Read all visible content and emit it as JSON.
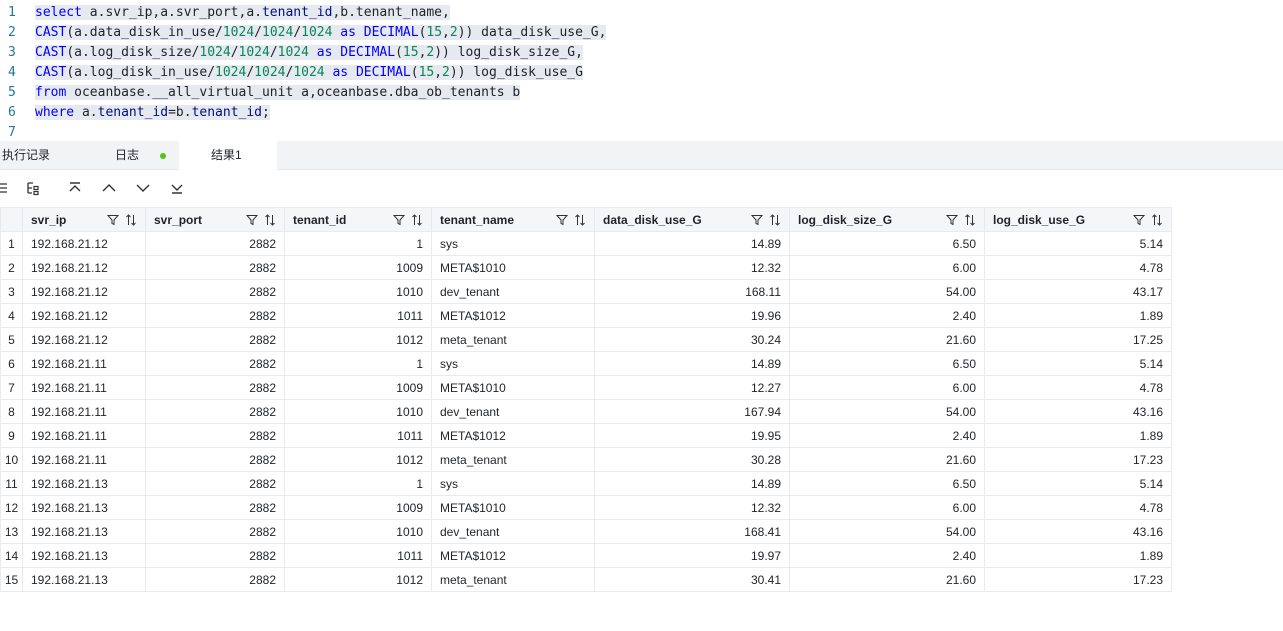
{
  "editor": {
    "lines": [
      {
        "no": "1"
      },
      {
        "no": "2"
      },
      {
        "no": "3"
      },
      {
        "no": "4"
      },
      {
        "no": "5"
      },
      {
        "no": "6"
      },
      {
        "no": "7"
      }
    ],
    "tokens": {
      "l1": [
        "select",
        " a.svr_ip,a.svr_port,a.",
        "tenant_id",
        ",b.tenant_name,"
      ],
      "l2": [
        "CAST",
        "(a.data_disk_in_use/",
        "1024",
        "/",
        "1024",
        "/",
        "1024",
        " as ",
        "DECIMAL",
        "(",
        "15",
        ",",
        "2",
        ")) data_disk_use_G,"
      ],
      "l3": [
        "CAST",
        "(a.log_disk_size/",
        "1024",
        "/",
        "1024",
        "/",
        "1024",
        " as ",
        "DECIMAL",
        "(",
        "15",
        ",",
        "2",
        ")) log_disk_size_G,"
      ],
      "l4": [
        "CAST",
        "(a.log_disk_in_use/",
        "1024",
        "/",
        "1024",
        "/",
        "1024",
        " as ",
        "DECIMAL",
        "(",
        "15",
        ",",
        "2",
        ")) log_disk_use_G"
      ],
      "l5": [
        "from",
        " oceanbase.__all_virtual_unit a,oceanbase.dba_ob_tenants b"
      ],
      "l6": [
        "where",
        " a.",
        "tenant_id",
        "=",
        "b.",
        "tenant_id",
        ";"
      ]
    }
  },
  "tabs": {
    "history": "执行记录",
    "log": "日志",
    "result": "结果1",
    "log_status_color": "#52c41a"
  },
  "toolbar": {
    "icons": [
      "column-settings-icon",
      "tree-structure-icon",
      "jump-first-icon",
      "move-up-icon",
      "move-down-icon",
      "jump-last-icon"
    ]
  },
  "grid": {
    "columns": [
      "svr_ip",
      "svr_port",
      "tenant_id",
      "tenant_name",
      "data_disk_use_G",
      "log_disk_size_G",
      "log_disk_use_G"
    ],
    "rows": [
      [
        "1",
        "192.168.21.12",
        "2882",
        "1",
        "sys",
        "14.89",
        "6.50",
        "5.14"
      ],
      [
        "2",
        "192.168.21.12",
        "2882",
        "1009",
        "META$1010",
        "12.32",
        "6.00",
        "4.78"
      ],
      [
        "3",
        "192.168.21.12",
        "2882",
        "1010",
        "dev_tenant",
        "168.11",
        "54.00",
        "43.17"
      ],
      [
        "4",
        "192.168.21.12",
        "2882",
        "1011",
        "META$1012",
        "19.96",
        "2.40",
        "1.89"
      ],
      [
        "5",
        "192.168.21.12",
        "2882",
        "1012",
        "meta_tenant",
        "30.24",
        "21.60",
        "17.25"
      ],
      [
        "6",
        "192.168.21.11",
        "2882",
        "1",
        "sys",
        "14.89",
        "6.50",
        "5.14"
      ],
      [
        "7",
        "192.168.21.11",
        "2882",
        "1009",
        "META$1010",
        "12.27",
        "6.00",
        "4.78"
      ],
      [
        "8",
        "192.168.21.11",
        "2882",
        "1010",
        "dev_tenant",
        "167.94",
        "54.00",
        "43.16"
      ],
      [
        "9",
        "192.168.21.11",
        "2882",
        "1011",
        "META$1012",
        "19.95",
        "2.40",
        "1.89"
      ],
      [
        "10",
        "192.168.21.11",
        "2882",
        "1012",
        "meta_tenant",
        "30.28",
        "21.60",
        "17.23"
      ],
      [
        "11",
        "192.168.21.13",
        "2882",
        "1",
        "sys",
        "14.89",
        "6.50",
        "5.14"
      ],
      [
        "12",
        "192.168.21.13",
        "2882",
        "1009",
        "META$1010",
        "12.32",
        "6.00",
        "4.78"
      ],
      [
        "13",
        "192.168.21.13",
        "2882",
        "1010",
        "dev_tenant",
        "168.41",
        "54.00",
        "43.16"
      ],
      [
        "14",
        "192.168.21.13",
        "2882",
        "1011",
        "META$1012",
        "19.97",
        "2.40",
        "1.89"
      ],
      [
        "15",
        "192.168.21.13",
        "2882",
        "1012",
        "meta_tenant",
        "30.41",
        "21.60",
        "17.23"
      ]
    ]
  }
}
